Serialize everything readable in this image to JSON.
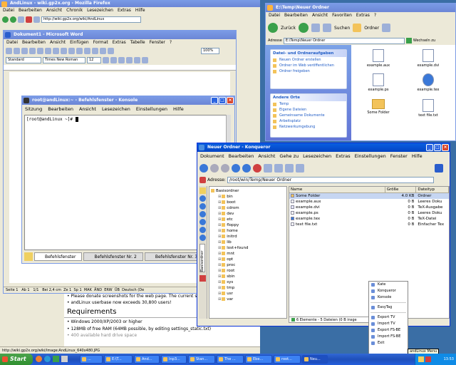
{
  "firefox": {
    "title": "AndLinux - wiki.gp2x.org - Mozilla Firefox",
    "menu": [
      "Datei",
      "Bearbeiten",
      "Ansicht",
      "Chronik",
      "Lesezeichen",
      "Extras",
      "Hilfe"
    ],
    "url": "http://wiki.gp2x.org/wiki/AndLinux",
    "status": "http://wiki.gp2x.org/wiki/Image:AndLinux_640x480.JPG",
    "content": {
      "para1": "Please donate screenshots for the web page. The current screen",
      "para2": "andLinux userbase now exceeds 30,800 users!",
      "heading": "Requirements",
      "req1": "Windows 2000/XP/2003 or higher",
      "req2": "128MB of free RAM (64MB possible, by editing settings_static.txt)",
      "req3": "400 available hard drive space"
    }
  },
  "word": {
    "title": "Dokument1 - Microsoft Word",
    "menu": [
      "Datei",
      "Bearbeiten",
      "Ansicht",
      "Einfügen",
      "Format",
      "Extras",
      "Tabelle",
      "Fenster",
      "?"
    ],
    "style": "Standard",
    "font": "Times New Roman",
    "size": "12",
    "zoom": "100%",
    "status": [
      "Seite 1",
      "Ab 1",
      "1/1",
      "Bei 2,4 cm",
      "Ze 1",
      "Sp 1",
      "MAK",
      "ÄND",
      "ERW",
      "ÜB",
      "Deutsch (De"
    ]
  },
  "konsole": {
    "title": "root@andLinux:~ - Befehlsfenster - Konsole",
    "menu": [
      "Sitzung",
      "Bearbeiten",
      "Ansicht",
      "Lesezeichen",
      "Einstellungen",
      "Hilfe"
    ],
    "prompt": "[root@andLinux ~]# ",
    "tabs": [
      "Befehlsfenster",
      "Befehlsfenster Nr. 2",
      "Befehlsfenster Nr. 3"
    ]
  },
  "explorer": {
    "title": "E:\\Temp\\Neuer Ordner",
    "menu": [
      "Datei",
      "Bearbeiten",
      "Ansicht",
      "Favoriten",
      "Extras",
      "?"
    ],
    "back": "Zurück",
    "search": "Suchen",
    "folders": "Ordner",
    "address_label": "Adresse",
    "address": "E:\\Temp\\Neuer Ordner",
    "go": "Wechseln zu",
    "panel1": {
      "title": "Datei- und Ordneraufgaben",
      "items": [
        "Neuen Ordner erstellen",
        "Ordner im Web veröffentlichen",
        "Ordner freigeben"
      ]
    },
    "panel2": {
      "title": "Andere Orte",
      "items": [
        "Temp",
        "Eigene Dateien",
        "Gemeinsame Dokumente",
        "Arbeitsplatz",
        "Netzwerkumgebung"
      ]
    },
    "files": [
      "example.aux",
      "example.dvi",
      "example.ps",
      "example.tex",
      "Some Folder",
      "text file.txt"
    ]
  },
  "konqueror": {
    "title": "Neuer Ordner - Konqueror",
    "menu": [
      "Dokument",
      "Bearbeiten",
      "Ansicht",
      "Gehe zu",
      "Lesezeichen",
      "Extras",
      "Einstellungen",
      "Fenster",
      "Hilfe"
    ],
    "address_label": "Adresse:",
    "address": "/root/win/Temp/Neuer Ordner",
    "tree_root": "Basisordner",
    "tree": [
      "bin",
      "boot",
      "cdrom",
      "dev",
      "etc",
      "floppy",
      "home",
      "initrd",
      "lib",
      "lost+found",
      "mnt",
      "opt",
      "proc",
      "root",
      "sbin",
      "sys",
      "tmp",
      "usr",
      "var"
    ],
    "side_tab": "Basisordner",
    "columns": [
      "Name",
      "Größe",
      "Dateityp"
    ],
    "rows": [
      [
        "Some Folder",
        "4.0 KB",
        "Ordner"
      ],
      [
        "example.aux",
        "0 B",
        "Leeres Doku"
      ],
      [
        "example.dvi",
        "0 B",
        "TeX-Ausgabe"
      ],
      [
        "example.ps",
        "0 B",
        "Leeres Doku"
      ],
      [
        "example.tex",
        "0 B",
        "TeX-Datei"
      ],
      [
        "text file.txt",
        "0 B",
        "Einfacher Tex"
      ]
    ],
    "status": "6 Elemente - 5 Dateien (0 B insge"
  },
  "context_menu": {
    "items": [
      "Kate",
      "Konqueror",
      "Konsole",
      "EasyTag",
      "Export TV",
      "Import TV",
      "Export FS-BE",
      "Import FS-BE",
      "Exit"
    ],
    "tooltip": "andLinux Menu"
  },
  "taskbar": {
    "start": "Start",
    "items": [
      "...",
      "E:\\T...",
      "And...",
      "Inp3...",
      "Stan...",
      "The ...",
      "Ebe...",
      "root...",
      "Neu..."
    ],
    "clock": "13:53"
  }
}
